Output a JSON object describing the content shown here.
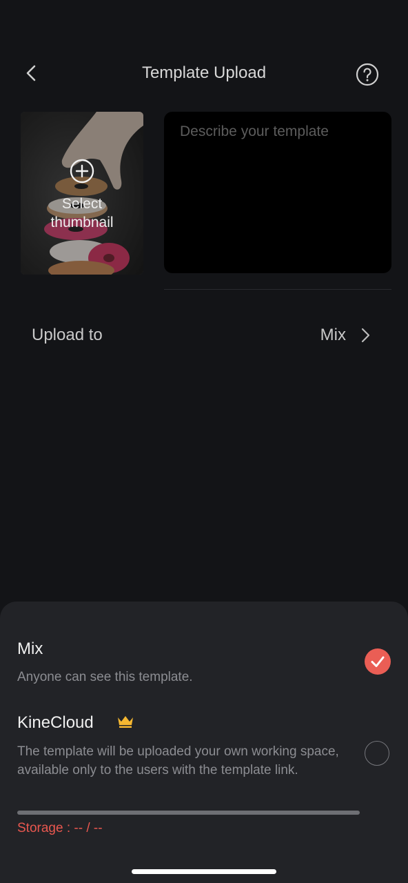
{
  "header": {
    "title": "Template Upload"
  },
  "thumbnail": {
    "label": "Select\nthumbnail"
  },
  "description": {
    "placeholder": "Describe your template"
  },
  "upload": {
    "label": "Upload to",
    "value": "Mix"
  },
  "sheet": {
    "options": [
      {
        "title": "Mix",
        "description": "Anyone can see this template.",
        "selected": true
      },
      {
        "title": "KineCloud",
        "description": "The template will be uploaded your own working space, available only to the users with the template link.",
        "selected": false,
        "badge_icon": "crown-icon"
      }
    ],
    "storage": "Storage : -- / --"
  },
  "colors": {
    "accent": "#ea5e55",
    "crown": "#f5b731",
    "background": "#131417",
    "sheet": "#222327"
  }
}
